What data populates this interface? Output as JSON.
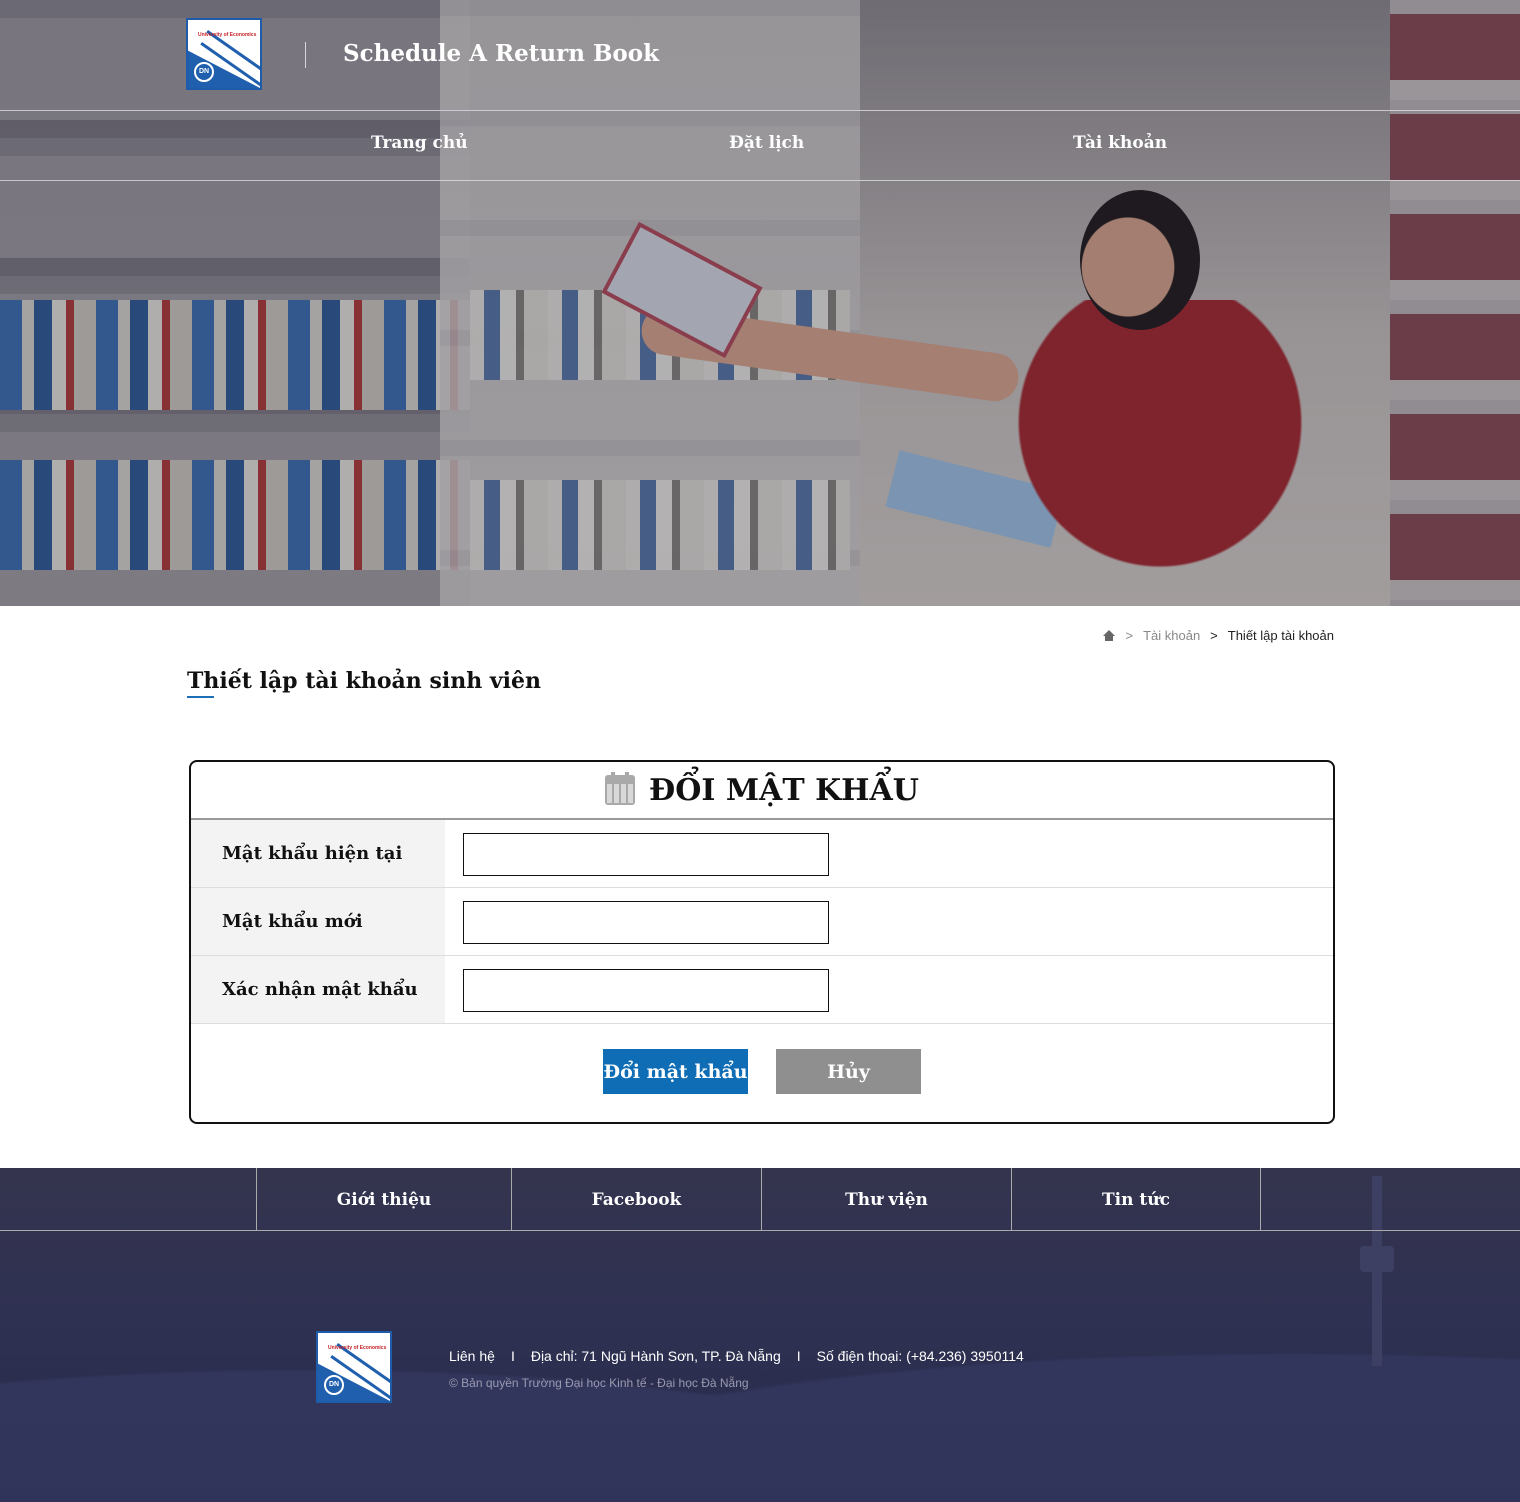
{
  "header": {
    "site_title": "Schedule A Return Book",
    "logo_text": "University of Economics",
    "logo_seal": "DN",
    "nav": [
      {
        "label": "Trang chủ"
      },
      {
        "label": "Đặt lịch"
      },
      {
        "label": "Tài khoản"
      }
    ]
  },
  "breadcrumb": {
    "items": [
      "Tài khoản",
      "Thiết lập tài khoản"
    ],
    "separator": ">"
  },
  "page": {
    "title": "Thiết lập tài khoản sinh viên"
  },
  "form": {
    "heading": "ĐỔI MẬT KHẨU",
    "heading_icon": "calendar-icon",
    "fields": [
      {
        "label": "Mật khẩu hiện tại",
        "value": ""
      },
      {
        "label": "Mật khẩu mới",
        "value": ""
      },
      {
        "label": "Xác nhận mật khẩu",
        "value": ""
      }
    ],
    "submit_label": "Đổi mật khẩu",
    "cancel_label": "Hủy"
  },
  "footer": {
    "nav": [
      {
        "label": "Giới thiệu"
      },
      {
        "label": "Facebook"
      },
      {
        "label": "Thư viện"
      },
      {
        "label": "Tin tức"
      }
    ],
    "contact": "Liên hệ",
    "address": "Địa chỉ: 71 Ngũ Hành Sơn, TP. Đà Nẵng",
    "phone": "Số điện thoại: (+84.236) 3950114",
    "divider": "I",
    "copyright": "© Bản quyền Trường Đại học Kinh tế - Đại học Đà Nẵng"
  },
  "colors": {
    "primary": "#0f6db5",
    "cancel": "#8f8f8f",
    "footer_bg": "#2f3152"
  }
}
